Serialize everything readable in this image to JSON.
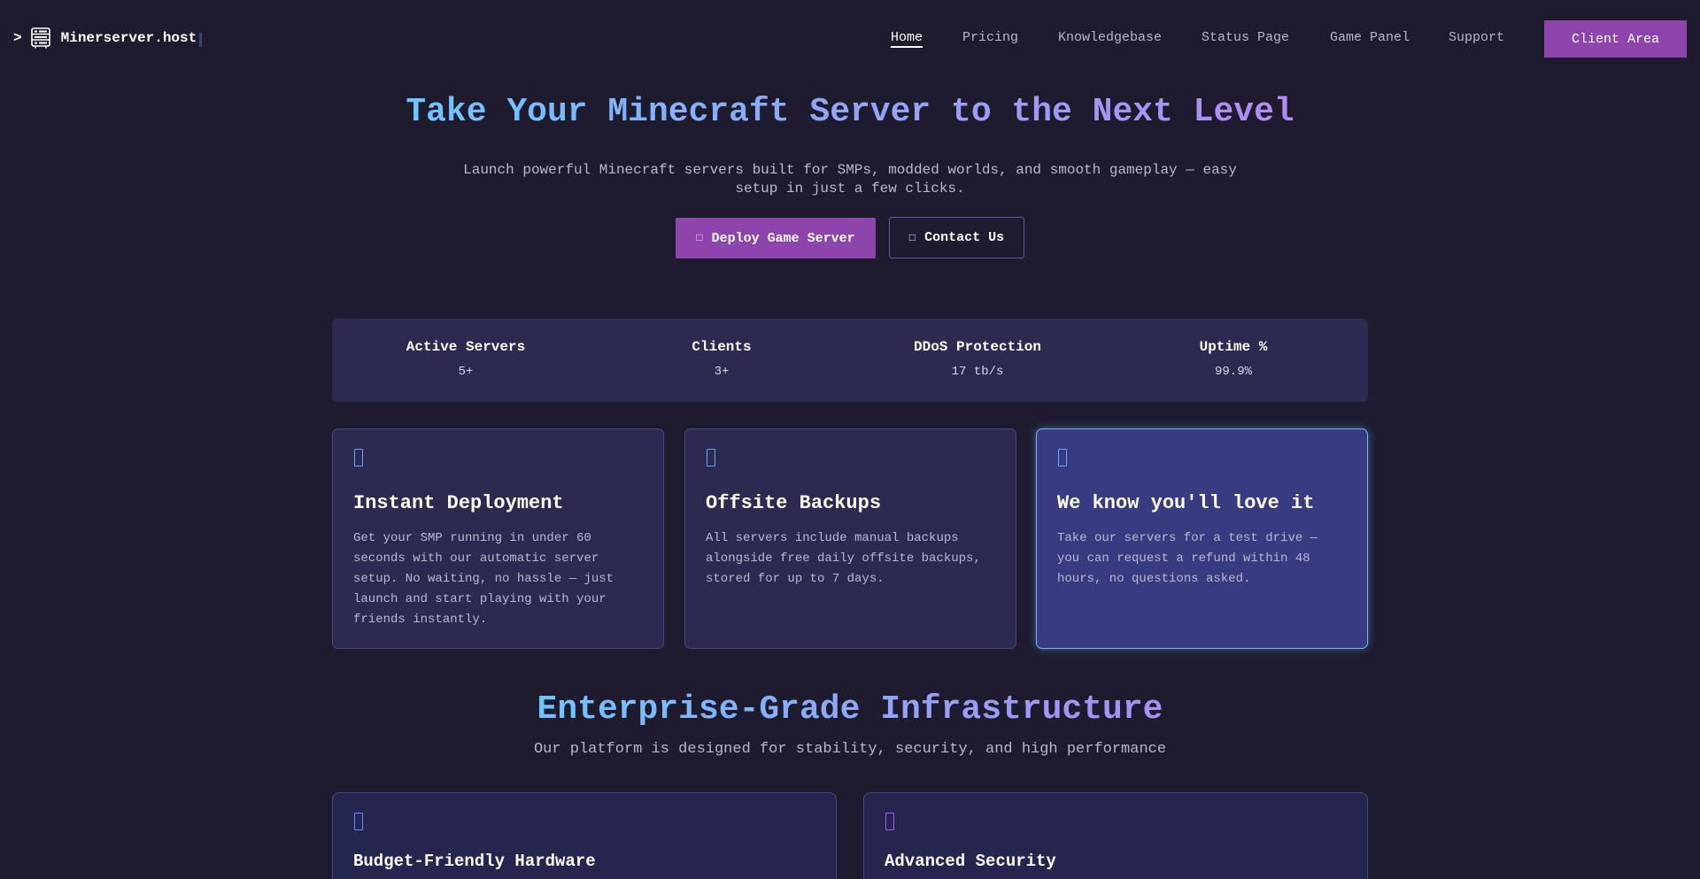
{
  "nav": {
    "prompt": ">",
    "brand": "Minerserver.host",
    "links": [
      "Home",
      "Pricing",
      "Knowledgebase",
      "Status Page",
      "Game Panel",
      "Support"
    ],
    "active": "Home",
    "client_button": "Client Area"
  },
  "hero": {
    "title": "Take Your Minecraft Server to the Next Level",
    "subtitle": "Launch powerful Minecraft servers built for SMPs, modded worlds, and smooth gameplay — easy setup in just a few clicks.",
    "deploy_button": "Deploy Game Server",
    "contact_button": "Contact Us",
    "deploy_icon": "rocket-icon",
    "contact_icon": "envelope-icon"
  },
  "stats": [
    {
      "label": "Active Servers",
      "value": "5+"
    },
    {
      "label": "Clients",
      "value": "3+"
    },
    {
      "label": "DDoS Protection",
      "value": "17 tb/s"
    },
    {
      "label": "Uptime %",
      "value": "99.9%"
    }
  ],
  "features": [
    {
      "icon": "bolt-icon",
      "title": "Instant Deployment",
      "text": "Get your SMP running in under 60 seconds with our automatic server setup. No waiting, no hassle — just launch and start playing with your friends instantly."
    },
    {
      "icon": "backup-icon",
      "title": "Offsite Backups",
      "text": "All servers include manual backups alongside free daily offsite backups, stored for up to 7 days."
    },
    {
      "icon": "heart-icon",
      "title": "We know you'll love it",
      "text": "Take our servers for a test drive — you can request a refund within 48 hours, no questions asked."
    }
  ],
  "infrastructure": {
    "title": "Enterprise-Grade Infrastructure",
    "subtitle": "Our platform is designed for stability, security, and high performance",
    "cards": [
      {
        "icon": "hardware-icon",
        "title": "Budget-Friendly Hardware"
      },
      {
        "icon": "shield-icon",
        "title": "Advanced Security"
      }
    ]
  },
  "colors": {
    "background": "#1e1b2e",
    "accent": "#8e44ad",
    "card": "#2d2a52",
    "highlight_border": "#6fb6ff"
  }
}
